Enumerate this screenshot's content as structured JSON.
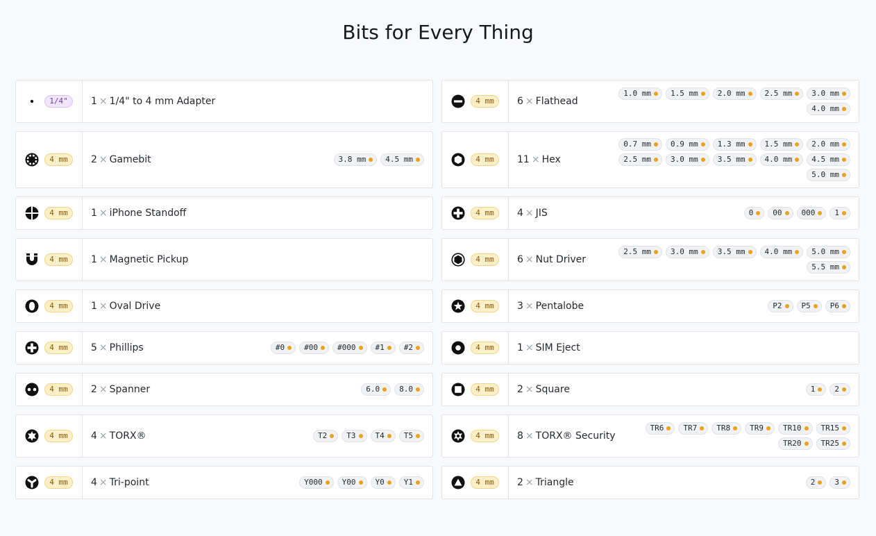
{
  "title": "Bits for Every Thing",
  "colors": {
    "accent_dot": "#eaa21d",
    "size_pill_bg": "#fdf0c9",
    "quarter_pill_bg": "#f0e6fb"
  },
  "left": [
    {
      "icon": "small-dot-icon",
      "size": "1/4\"",
      "qty": "1",
      "name": "1/4\" to 4 mm Adapter",
      "bits": []
    },
    {
      "icon": "gamebit-icon",
      "size": "4 mm",
      "qty": "2",
      "name": "Gamebit",
      "bits": [
        "3.8 mm",
        "4.5 mm"
      ]
    },
    {
      "icon": "iphone-standoff-icon",
      "size": "4 mm",
      "qty": "1",
      "name": "iPhone Standoff",
      "bits": []
    },
    {
      "icon": "magnet-icon",
      "size": "4 mm",
      "qty": "1",
      "name": "Magnetic Pickup",
      "bits": []
    },
    {
      "icon": "oval-drive-icon",
      "size": "4 mm",
      "qty": "1",
      "name": "Oval Drive",
      "bits": []
    },
    {
      "icon": "phillips-icon",
      "size": "4 mm",
      "qty": "5",
      "name": "Phillips",
      "bits": [
        "#0",
        "#00",
        "#000",
        "#1",
        "#2"
      ]
    },
    {
      "icon": "spanner-icon",
      "size": "4 mm",
      "qty": "2",
      "name": "Spanner",
      "bits": [
        "6.0",
        "8.0"
      ]
    },
    {
      "icon": "torx-icon",
      "size": "4 mm",
      "qty": "4",
      "name": "TORX®",
      "bits": [
        "T2",
        "T3",
        "T4",
        "T5"
      ]
    },
    {
      "icon": "tri-point-icon",
      "size": "4 mm",
      "qty": "4",
      "name": "Tri-point",
      "bits": [
        "Y000",
        "Y00",
        "Y0",
        "Y1"
      ]
    }
  ],
  "right": [
    {
      "icon": "flathead-icon",
      "size": "4 mm",
      "qty": "6",
      "name": "Flathead",
      "bits": [
        "1.0 mm",
        "1.5 mm",
        "2.0 mm",
        "2.5 mm",
        "3.0 mm",
        "4.0 mm"
      ]
    },
    {
      "icon": "hex-icon",
      "size": "4 mm",
      "qty": "11",
      "name": "Hex",
      "bits": [
        "0.7 mm",
        "0.9 mm",
        "1.3 mm",
        "1.5 mm",
        "2.0 mm",
        "2.5 mm",
        "3.0 mm",
        "3.5 mm",
        "4.0 mm",
        "4.5 mm",
        "5.0 mm"
      ]
    },
    {
      "icon": "jis-icon",
      "size": "4 mm",
      "qty": "4",
      "name": "JIS",
      "bits": [
        "0",
        "00",
        "000",
        "1"
      ]
    },
    {
      "icon": "nut-driver-icon",
      "size": "4 mm",
      "qty": "6",
      "name": "Nut Driver",
      "bits": [
        "2.5 mm",
        "3.0 mm",
        "3.5 mm",
        "4.0 mm",
        "5.0 mm",
        "5.5 mm"
      ]
    },
    {
      "icon": "pentalobe-icon",
      "size": "4 mm",
      "qty": "3",
      "name": "Pentalobe",
      "bits": [
        "P2",
        "P5",
        "P6"
      ]
    },
    {
      "icon": "sim-eject-icon",
      "size": "4 mm",
      "qty": "1",
      "name": "SIM Eject",
      "bits": []
    },
    {
      "icon": "square-icon",
      "size": "4 mm",
      "qty": "2",
      "name": "Square",
      "bits": [
        "1",
        "2"
      ]
    },
    {
      "icon": "torx-security-icon",
      "size": "4 mm",
      "qty": "8",
      "name": "TORX® Security",
      "bits": [
        "TR6",
        "TR7",
        "TR8",
        "TR9",
        "TR10",
        "TR15",
        "TR20",
        "TR25"
      ]
    },
    {
      "icon": "triangle-icon",
      "size": "4 mm",
      "qty": "2",
      "name": "Triangle",
      "bits": [
        "2",
        "3"
      ]
    }
  ]
}
